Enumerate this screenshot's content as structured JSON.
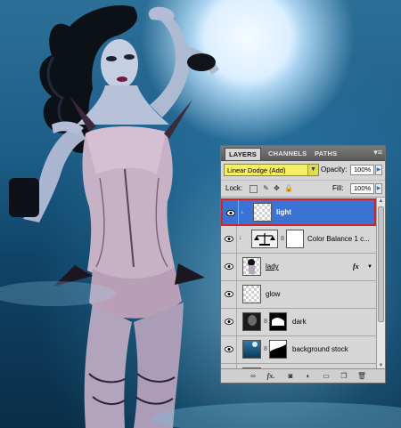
{
  "panel": {
    "tabs": [
      {
        "label": "LAYERS",
        "active": true
      },
      {
        "label": "CHANNELS",
        "active": false
      },
      {
        "label": "PATHS",
        "active": false
      }
    ],
    "close_glyph": "×",
    "menu_glyph": "▾≡"
  },
  "blend_mode": {
    "value": "Linear Dodge (Add)",
    "highlight_color": "#f6ef63"
  },
  "opacity": {
    "label": "Opacity:",
    "value": "100%"
  },
  "lock": {
    "label": "Lock:",
    "icons": [
      "lock-transparent-pixels-icon",
      "lock-image-pixels-icon",
      "lock-position-icon",
      "lock-all-icon"
    ]
  },
  "fill": {
    "label": "Fill:",
    "value": "100%"
  },
  "layers": [
    {
      "name": "light",
      "visible": true,
      "selected": true,
      "thumb": "transparent",
      "clipped": true
    },
    {
      "name": "Color Balance 1 c...",
      "visible": true,
      "selected": false,
      "thumb": "adjustment",
      "clipped": true,
      "has_mask": true
    },
    {
      "name": "lady",
      "visible": true,
      "selected": false,
      "thumb": "image",
      "has_fx": true,
      "fx_label": "fx",
      "underlined": true
    },
    {
      "name": "glow",
      "visible": true,
      "selected": false,
      "thumb": "transparent"
    },
    {
      "name": "dark",
      "visible": true,
      "selected": false,
      "thumb": "image",
      "has_mask": true
    },
    {
      "name": "background stock",
      "visible": true,
      "selected": false,
      "thumb": "image",
      "has_mask": true
    }
  ],
  "bottom_buttons": [
    "link-layers-icon",
    "add-layer-style-icon",
    "add-mask-icon",
    "new-fill-adjustment-icon",
    "new-group-icon",
    "new-layer-icon",
    "delete-layer-icon"
  ],
  "colors": {
    "selection": "#3a73d4",
    "selection_border": "#d2232a"
  }
}
